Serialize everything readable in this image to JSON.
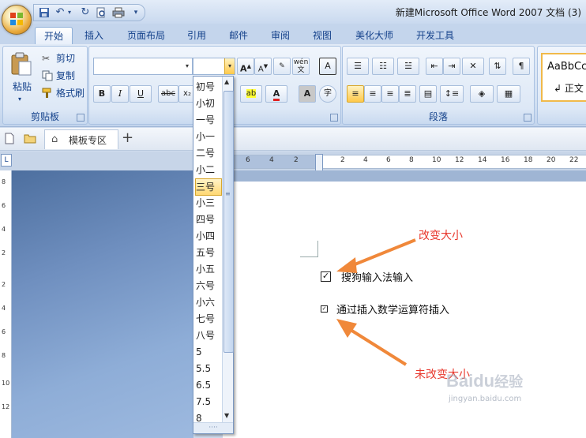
{
  "window": {
    "title": "新建Microsoft Office Word 2007 文档 (3)"
  },
  "quick_access": {
    "icons": [
      "save-icon",
      "undo-icon",
      "redo-icon",
      "print-preview-icon",
      "print-icon"
    ]
  },
  "tabs": [
    {
      "label": "开始",
      "active": true
    },
    {
      "label": "插入"
    },
    {
      "label": "页面布局"
    },
    {
      "label": "引用"
    },
    {
      "label": "邮件"
    },
    {
      "label": "审阅"
    },
    {
      "label": "视图"
    },
    {
      "label": "美化大师"
    },
    {
      "label": "开发工具"
    }
  ],
  "clipboard": {
    "paste_label": "粘贴",
    "cut_label": "剪切",
    "copy_label": "复制",
    "format_painter_label": "格式刷",
    "group_label": "剪贴板"
  },
  "font": {
    "font_name_value": "",
    "font_size_value": "",
    "grow_glyph": "A",
    "shrink_glyph": "A",
    "bold": "B",
    "italic": "I",
    "underline": "U",
    "strike": "abc",
    "subscript": "x₂",
    "highlight_glyph": "ab",
    "font_color_glyph": "A",
    "char_shade_glyph": "A",
    "enclose_glyph": "字",
    "pinyin_glyph": "wén",
    "pinyin_char": "文",
    "char_border_glyph": "A"
  },
  "paragraph": {
    "group_label": "段落"
  },
  "styles": {
    "preview_text": "AaBbCc",
    "normal_label": "↲ 正文"
  },
  "font_size_dropdown": {
    "items": [
      "初号",
      "小初",
      "一号",
      "小一",
      "二号",
      "小二",
      "三号",
      "小三",
      "四号",
      "小四",
      "五号",
      "小五",
      "六号",
      "小六",
      "七号",
      "八号",
      "5",
      "5.5",
      "6.5",
      "7.5",
      "8"
    ],
    "selected": "三号"
  },
  "doc_tabs": {
    "template_tab_label": "模板专区",
    "add_label": "+"
  },
  "hruler": {
    "left_labels": [
      "6",
      "4",
      "2"
    ],
    "right_labels": [
      "2",
      "4",
      "6",
      "8",
      "10",
      "12",
      "14",
      "16",
      "18",
      "20",
      "22"
    ]
  },
  "vruler": {
    "labels": [
      "8",
      "6",
      "4",
      "2",
      "2",
      "4",
      "6",
      "8",
      "10",
      "12"
    ]
  },
  "document": {
    "line1_text": "搜狗输入法输入",
    "line1_checkbox": "✓",
    "line2_text": "通过插入数学运算符插入",
    "line2_checkbox": "✓",
    "note_changed": "改变大小",
    "note_unchanged": "未改变大小"
  },
  "watermark": {
    "logo_text": "Baidu",
    "logo_cn": "经验",
    "url": "jingyan.baidu.com"
  },
  "colors": {
    "annotation_red": "#e8392e",
    "arrow_orange": "#f0883a",
    "ribbon_blue": "#15428b",
    "selected_item": "#ffd873"
  }
}
